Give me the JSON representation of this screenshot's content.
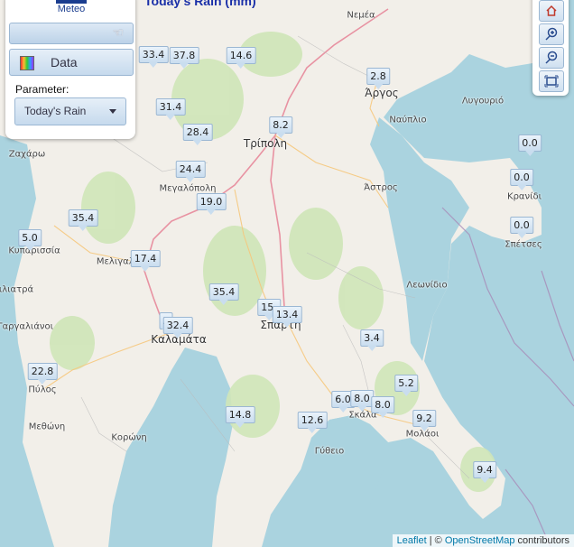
{
  "header": {
    "title": "Today's Rain (mm)",
    "logo_text": "Meteo"
  },
  "panel": {
    "data_button_label": "Data",
    "parameter_label": "Parameter:",
    "parameter_selected": "Today's Rain"
  },
  "map_labels": {
    "nemea": "Νεμέα",
    "argos": "Άργος",
    "nafplio": "Ναύπλιο",
    "lygourio": "Λυγουριό",
    "tripoli": "Τρίπολη",
    "zacharo": "Ζαχάρω",
    "megalopoli": "Μεγαλόπολη",
    "astros": "Άστρος",
    "kranidi": "Κρανίδι",
    "spetses": "Σπέτσες",
    "kyparissia": "Κυπαρισσία",
    "melia": "Μελιγαλάς",
    "filiatra": "Φιλιατρά",
    "gargalianoi": "Γαργαλιάνοι",
    "leonidio": "Λεωνίδιο",
    "sparti": "Σπάρτη",
    "kalamata": "Καλαμάτα",
    "pylos": "Πύλος",
    "methoni": "Μεθώνη",
    "koroni": "Κορώνη",
    "skala": "Σκάλα",
    "molaoi": "Μολάοι",
    "gytheio": "Γύθειο"
  },
  "stations": {
    "s1": "33.4",
    "s2": "37.8",
    "s3": "14.6",
    "s4": "2.8",
    "s5": "31.4",
    "s6": "8.2",
    "s7": "28.4",
    "s8": "0.0",
    "s9": "24.4",
    "s10": "0.0",
    "s11": "19.0",
    "s12": "35.4",
    "s13": "0.0",
    "s14": "5.0",
    "s15": "17.4",
    "s16": "35.4",
    "s17": "15.",
    "s18": "13.4",
    "s19": "2",
    "s20": "32.4",
    "s21": "3.4",
    "s22": "22.8",
    "s23": "5.2",
    "s24": "6.0",
    "s25": "8.0",
    "s26": "8.0",
    "s27": "14.8",
    "s28": "12.6",
    "s29": "9.2",
    "s30": "9.4"
  },
  "attribution": {
    "leaflet": "Leaflet",
    "separator": " | © ",
    "osm": "OpenStreetMap",
    "contributors": " contributors"
  },
  "icons": {
    "home": "home-icon",
    "zoom_in": "zoom-in-icon",
    "zoom_out": "zoom-out-icon",
    "fullscreen": "fullscreen-icon"
  }
}
